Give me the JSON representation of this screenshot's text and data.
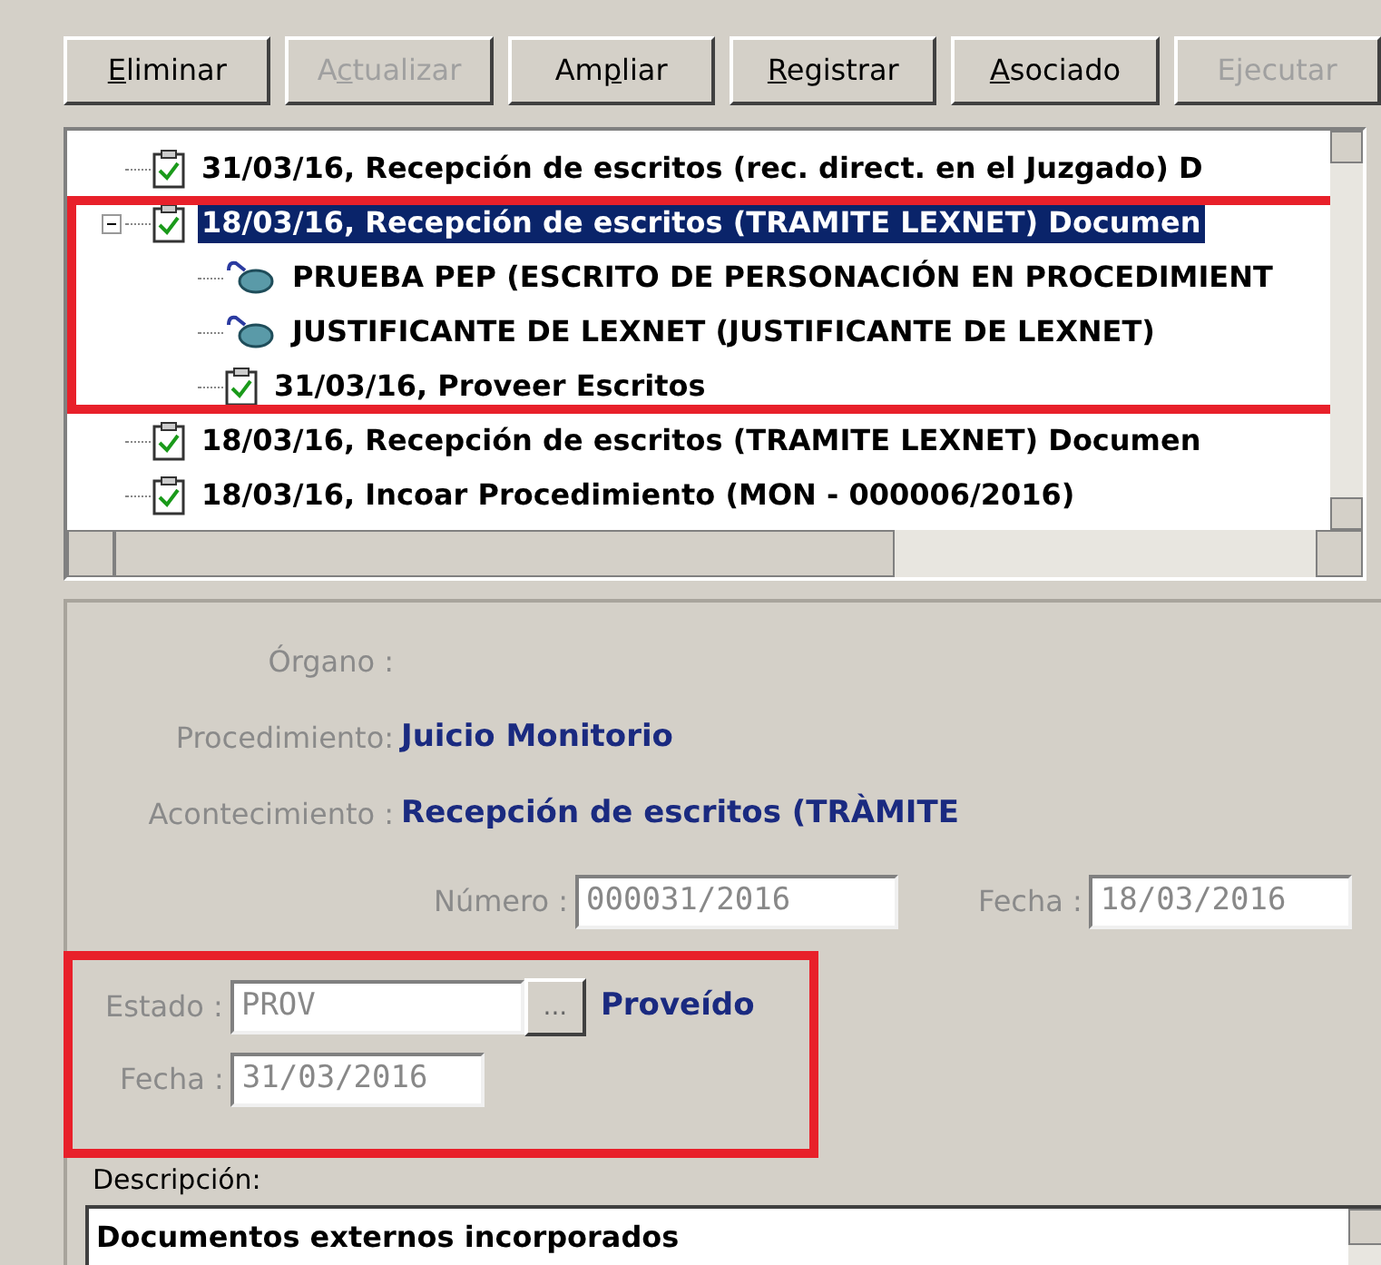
{
  "toolbar": [
    {
      "key": "E",
      "after": "liminar",
      "disabled": false
    },
    {
      "before": "A",
      "key": "c",
      "after": "tualizar",
      "disabled": true
    },
    {
      "before": "Am",
      "key": "p",
      "after": "liar",
      "disabled": false
    },
    {
      "key": "R",
      "after": "egistrar",
      "disabled": false
    },
    {
      "key": "A",
      "after": "sociado",
      "disabled": false
    },
    {
      "before": "E",
      "key": "j",
      "after": "ecutar",
      "disabled": true
    }
  ],
  "tree": [
    {
      "kind": "task",
      "label": "31/03/16, Recepción de escritos (rec. direct. en el Juzgado) D",
      "selected": false,
      "highlighted": false
    },
    {
      "kind": "task",
      "label": "18/03/16, Recepción de escritos (TRAMITE LEXNET) Documen",
      "selected": true,
      "highlighted": true,
      "expanded": true,
      "children": [
        {
          "kind": "document",
          "label": "PRUEBA PEP (ESCRITO DE PERSONACIÓN EN PROCEDIMIENT",
          "selected": false
        },
        {
          "kind": "document",
          "label": "JUSTIFICANTE DE LEXNET (JUSTIFICANTE DE LEXNET)",
          "selected": false
        },
        {
          "kind": "task",
          "label": "31/03/16, Proveer Escritos",
          "selected": false
        }
      ]
    },
    {
      "kind": "task",
      "label": "18/03/16, Recepción de escritos (TRAMITE LEXNET) Documen",
      "selected": false,
      "highlighted": false
    },
    {
      "kind": "task",
      "label": "18/03/16, Incoar Procedimiento (MON - 000006/2016)",
      "selected": false,
      "highlighted": false
    }
  ],
  "details": {
    "organo": {
      "label": "Órgano :"
    },
    "procedimiento": {
      "label": "Procedimiento:",
      "value": "Juicio Monitorio"
    },
    "acontecimiento": {
      "label": "Acontecimiento :",
      "value": "Recepción de escritos (TRÀMITE"
    },
    "numero": {
      "label": "Número :",
      "value": "000031/2016",
      "disabled": true
    },
    "fecha": {
      "label": "Fecha :",
      "value": "18/03/2016",
      "disabled": true
    },
    "estado_group": {
      "highlighted": true,
      "estado": {
        "label": "Estado :",
        "value": "PROV",
        "disabled": true,
        "button": "...",
        "text": "Proveído"
      },
      "fecha": {
        "label": "Fecha :",
        "value": "31/03/2016",
        "disabled": true
      }
    },
    "descripcion": {
      "label": "Descripción:",
      "value": "Documentos externos incorporados"
    }
  }
}
